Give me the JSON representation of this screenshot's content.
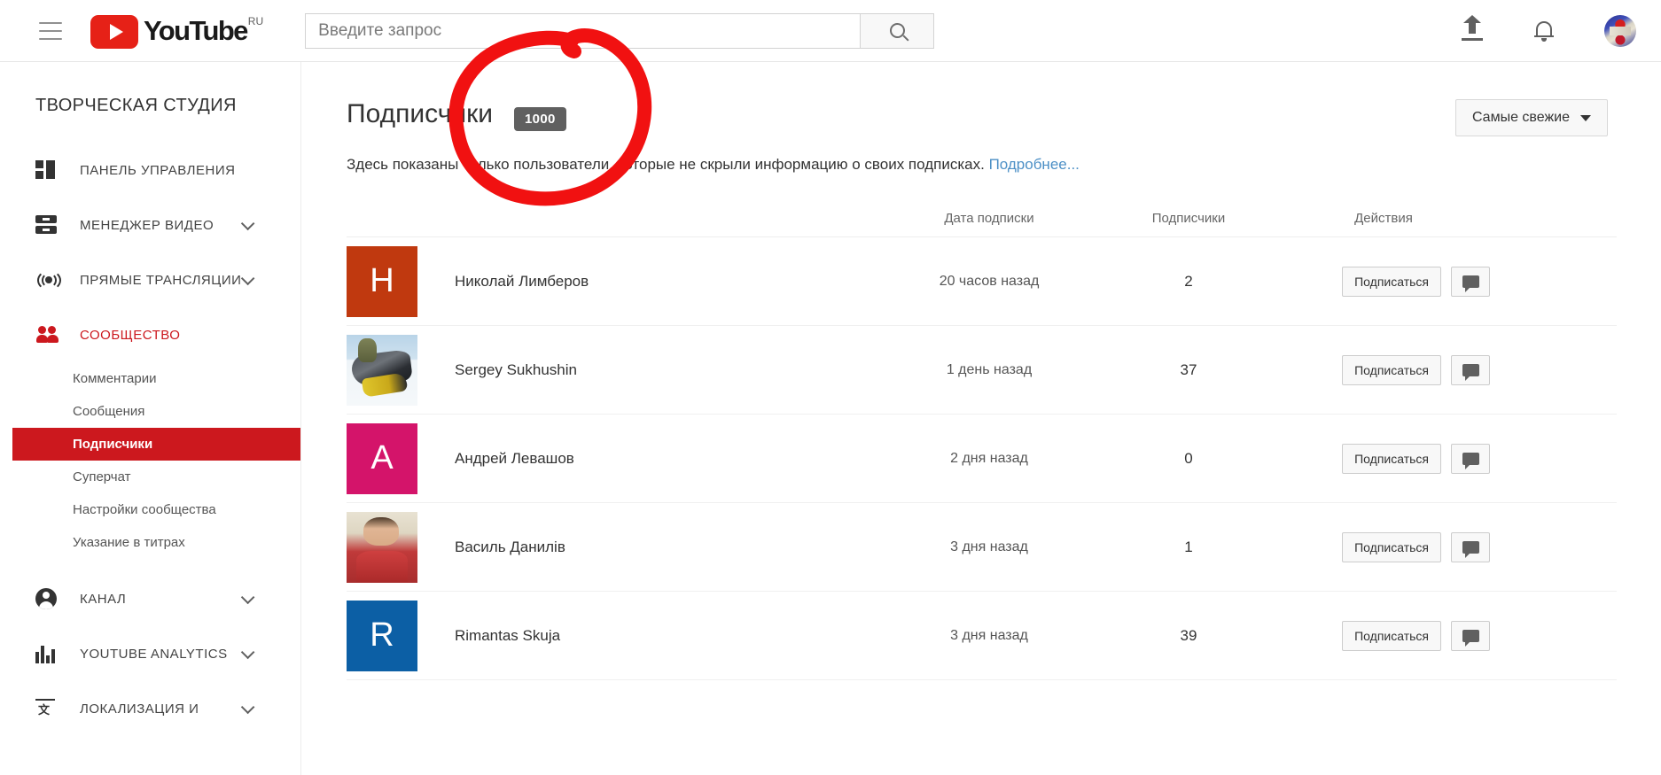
{
  "header": {
    "menu_icon": "hamburger-icon",
    "logo_text": "YouTube",
    "logo_country": "RU",
    "search_placeholder": "Введите запрос",
    "search_value": "",
    "search_icon": "search-icon",
    "upload_icon": "upload-icon",
    "notifications_icon": "bell-icon",
    "avatar_icon": "account-avatar"
  },
  "sidebar": {
    "title": "ТВОРЧЕСКАЯ СТУДИЯ",
    "items": [
      {
        "label": "ПАНЕЛЬ УПРАВЛЕНИЯ",
        "icon": "dashboard-icon",
        "expandable": false,
        "active": false
      },
      {
        "label": "МЕНЕДЖЕР ВИДЕО",
        "icon": "video-manager-icon",
        "expandable": true,
        "active": false
      },
      {
        "label": "ПРЯМЫЕ ТРАНСЛЯЦИИ",
        "icon": "live-broadcast-icon",
        "expandable": true,
        "active": false
      },
      {
        "label": "СООБЩЕСТВО",
        "icon": "community-icon",
        "expandable": false,
        "active": true
      },
      {
        "label": "КАНАЛ",
        "icon": "channel-icon",
        "expandable": true,
        "active": false
      },
      {
        "label": "YOUTUBE ANALYTICS",
        "icon": "analytics-icon",
        "expandable": true,
        "active": false
      },
      {
        "label": "ЛОКАЛИЗАЦИЯ И",
        "icon": "localization-icon",
        "expandable": true,
        "active": false
      }
    ],
    "community_subitems": [
      {
        "label": "Комментарии",
        "active": false
      },
      {
        "label": "Сообщения",
        "active": false
      },
      {
        "label": "Подписчики",
        "active": true
      },
      {
        "label": "Суперчат",
        "active": false
      },
      {
        "label": "Настройки сообщества",
        "active": false
      },
      {
        "label": "Указание в титрах",
        "active": false
      }
    ]
  },
  "main": {
    "page_title": "Подписчики",
    "count_badge": "1000",
    "sort_label": "Самые свежие",
    "sort_caret_icon": "chevron-down-icon",
    "subtitle_text": "Здесь показаны только пользователи, которые не скрыли информацию о своих подписках.",
    "subtitle_link": "Подробнее...",
    "columns": {
      "user": "",
      "date": "Дата подписки",
      "subscribers": "Подписчики",
      "actions": "Действия"
    },
    "subscribe_label": "Подписаться",
    "message_icon": "message-icon",
    "rows": [
      {
        "name": "Николай Лимберов",
        "avatar_letter": "Н",
        "avatar_color": "#C0390F",
        "avatar_type": "letter",
        "date": "20 часов назад",
        "subscribers": "2"
      },
      {
        "name": "Sergey Sukhushin",
        "avatar_letter": "",
        "avatar_color": "#9cc3dd",
        "avatar_type": "photo-snowmobile",
        "date": "1 день назад",
        "subscribers": "37"
      },
      {
        "name": "Андрей Левашов",
        "avatar_letter": "А",
        "avatar_color": "#D4146A",
        "avatar_type": "letter",
        "date": "2 дня назад",
        "subscribers": "0"
      },
      {
        "name": "Василь Данилів",
        "avatar_letter": "",
        "avatar_color": "#c24040",
        "avatar_type": "photo-portrait",
        "date": "3 дня назад",
        "subscribers": "1"
      },
      {
        "name": "Rimantas Skuja",
        "avatar_letter": "R",
        "avatar_color": "#0C5FA5",
        "avatar_type": "letter",
        "date": "3 дня назад",
        "subscribers": "39"
      }
    ]
  },
  "annotation": {
    "type": "hand-drawn-circle",
    "color": "#F11111",
    "target": "count_badge"
  },
  "colors": {
    "brand_red": "#cc181e",
    "youtube_red": "#e62117",
    "link_blue": "#4d90c6",
    "badge_gray": "#606060",
    "annotation_red": "#F11111"
  }
}
